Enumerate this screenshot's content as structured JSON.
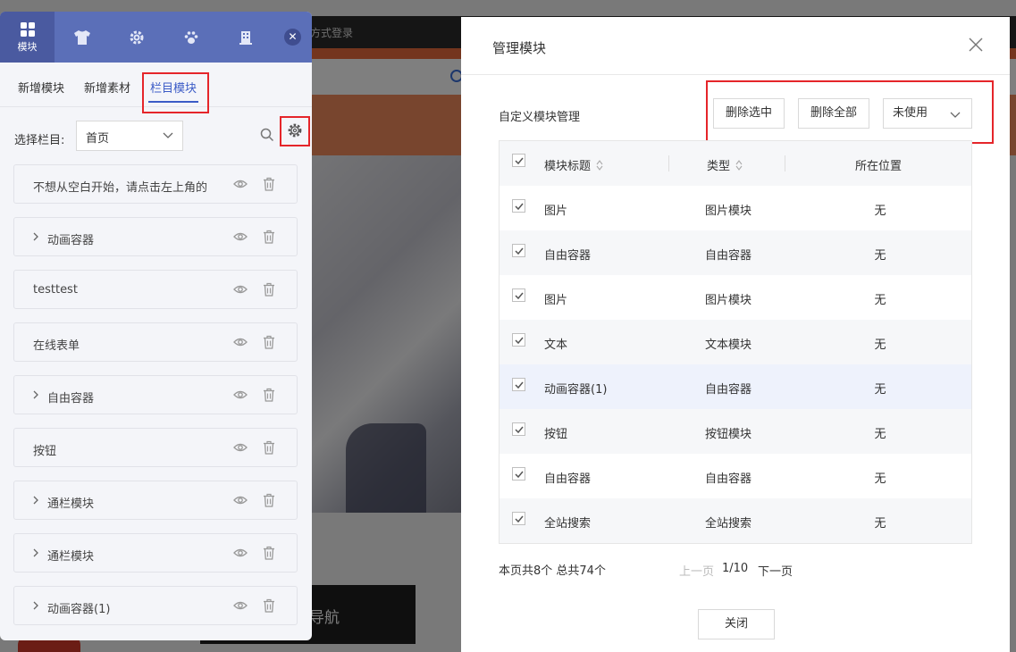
{
  "background": {
    "login_text": "方式登录",
    "nav_text": "导航"
  },
  "panel": {
    "tabs": [
      {
        "label": "模块",
        "icon": "grid-icon"
      },
      {
        "label": "",
        "icon": "shirt-icon"
      },
      {
        "label": "",
        "icon": "gear-icon"
      },
      {
        "label": "",
        "icon": "paw-icon"
      },
      {
        "label": "",
        "icon": "building-icon"
      }
    ],
    "subtabs": [
      "新增模块",
      "新增素材",
      "栏目模块"
    ],
    "active_subtab": "栏目模块",
    "select_label": "选择栏目:",
    "select_value": "首页",
    "items": [
      {
        "text": "不想从空白开始，请点击左上角的",
        "expandable": false
      },
      {
        "text": "动画容器",
        "expandable": true
      },
      {
        "text": "testtest",
        "expandable": false
      },
      {
        "text": "在线表单",
        "expandable": false
      },
      {
        "text": "自由容器",
        "expandable": true
      },
      {
        "text": "按钮",
        "expandable": false
      },
      {
        "text": "通栏模块",
        "expandable": true
      },
      {
        "text": "通栏模块",
        "expandable": true
      },
      {
        "text": "动画容器(1)",
        "expandable": true
      }
    ]
  },
  "dialog": {
    "title": "管理模块",
    "section_title": "自定义模块管理",
    "delete_selected": "删除选中",
    "delete_all": "删除全部",
    "filter_value": "未使用",
    "columns": [
      "模块标题",
      "类型",
      "所在位置"
    ],
    "rows": [
      {
        "title": "图片",
        "type": "图片模块",
        "location": "无"
      },
      {
        "title": "自由容器",
        "type": "自由容器",
        "location": "无"
      },
      {
        "title": "图片",
        "type": "图片模块",
        "location": "无"
      },
      {
        "title": "文本",
        "type": "文本模块",
        "location": "无"
      },
      {
        "title": "动画容器(1)",
        "type": "自由容器",
        "location": "无"
      },
      {
        "title": "按钮",
        "type": "按钮模块",
        "location": "无"
      },
      {
        "title": "自由容器",
        "type": "自由容器",
        "location": "无"
      },
      {
        "title": "全站搜索",
        "type": "全站搜索",
        "location": "无"
      }
    ],
    "pagination": {
      "summary": "本页共8个  总共74个",
      "prev": "上一页",
      "page": "1/10",
      "next": "下一页"
    },
    "close_label": "关闭"
  },
  "colors": {
    "accent": "#3b5bc6",
    "panel_header": "#5b6fb8",
    "highlight_box": "#e5252a"
  }
}
